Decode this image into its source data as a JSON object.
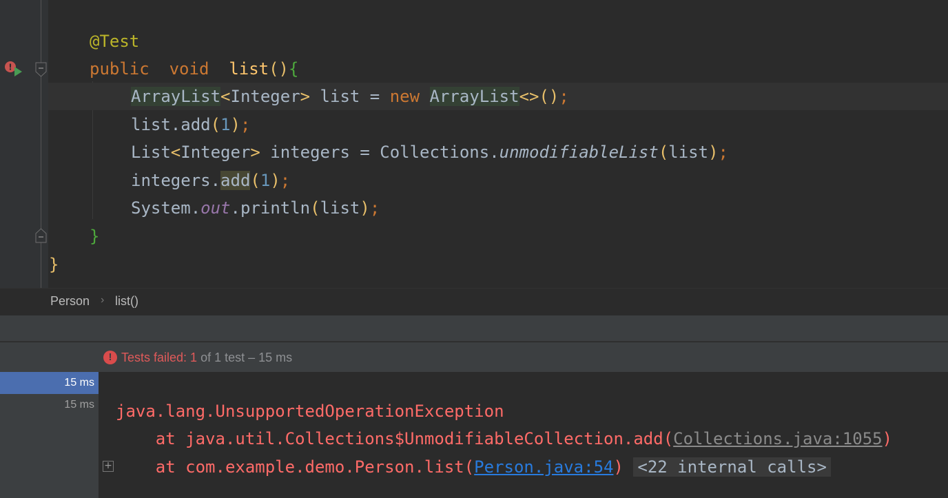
{
  "editor": {
    "annotation": "@Test",
    "signature": {
      "public": "public",
      "void": "void",
      "name": "list",
      "parens": "()",
      "brace": "{"
    },
    "line3": {
      "type": "ArrayList",
      "lt": "<",
      "generic": "Integer",
      "gt": ">",
      "var": " list = ",
      "new": "new",
      "type2": "ArrayList",
      "diamond": "<>",
      "tail": "()",
      "semi": ";"
    },
    "line4": {
      "pre": "list.add",
      "open": "(",
      "num": "1",
      "close": ")",
      "semi": ";"
    },
    "line5": {
      "type": "List",
      "lt": "<",
      "generic": "Integer",
      "gt": ">",
      "mid": " integers = Collections.",
      "method": "unmodifiableList",
      "open": "(",
      "arg": "list",
      "close": ")",
      "semi": ";"
    },
    "line6": {
      "pre": "integers.",
      "method": "add",
      "open": "(",
      "num": "1",
      "close": ")",
      "semi": ";"
    },
    "line7": {
      "pre": "System.",
      "field": "out",
      "mid": ".println",
      "open": "(",
      "arg": "list",
      "close": ")",
      "semi": ";"
    },
    "close_method": "}",
    "close_class": "}"
  },
  "breadcrumb": {
    "class": "Person",
    "separator": "›",
    "method": "list()"
  },
  "status": {
    "failed_label": "Tests failed: 1",
    "rest": " of 1 test – 15 ms"
  },
  "tree": {
    "rows": [
      "15 ms",
      "15 ms"
    ]
  },
  "console": {
    "exception": "java.lang.UnsupportedOperationException",
    "frame1_prefix": "    at java.util.Collections$UnmodifiableCollection.add(",
    "frame1_link": "Collections.java:1055",
    "frame1_suffix": ")",
    "frame2_prefix": "    at com.example.demo.Person.list(",
    "frame2_link": "Person.java:54",
    "frame2_suffix": ")",
    "internal": "<22 internal calls>",
    "expand": "+"
  },
  "colors": {
    "error": "#ff6b68",
    "link": "#287bde",
    "selection": "#4b6eaf",
    "keyword": "#cc7832",
    "annotation": "#bbb529"
  }
}
